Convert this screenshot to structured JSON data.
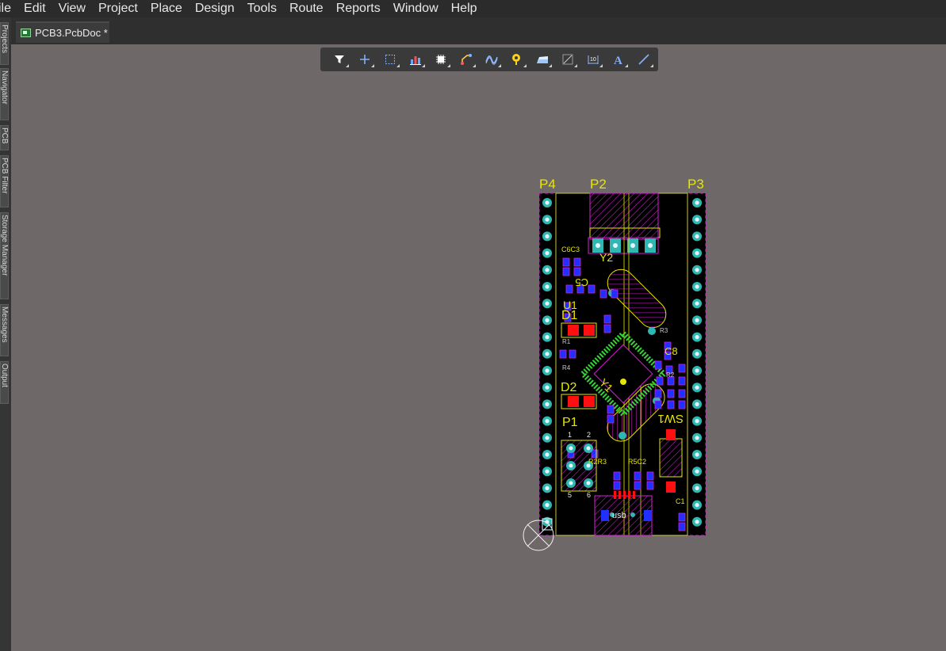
{
  "menu": {
    "items": [
      {
        "label": "ile",
        "name": "menu-file"
      },
      {
        "label": "Edit",
        "name": "menu-edit"
      },
      {
        "label": "View",
        "name": "menu-view"
      },
      {
        "label": "Project",
        "name": "menu-project"
      },
      {
        "label": "Place",
        "name": "menu-place"
      },
      {
        "label": "Design",
        "name": "menu-design"
      },
      {
        "label": "Tools",
        "name": "menu-tools"
      },
      {
        "label": "Route",
        "name": "menu-route"
      },
      {
        "label": "Reports",
        "name": "menu-reports"
      },
      {
        "label": "Window",
        "name": "menu-window"
      },
      {
        "label": "Help",
        "name": "menu-help"
      }
    ]
  },
  "tab": {
    "label": "PCB3.PcbDoc *"
  },
  "left_panels": [
    "Projects",
    "Navigator",
    "PCB",
    "PCB Filter",
    "Storage Manager",
    "Messages",
    "Output"
  ],
  "toolbar": {
    "buttons": [
      "filter-icon",
      "cross-add-icon",
      "select-rect-icon",
      "chart-icon",
      "component-icon",
      "route-icon",
      "diff-pair-icon",
      "via-icon",
      "polygon-icon",
      "rect-icon",
      "dimension-icon",
      "text-icon",
      "line-icon"
    ]
  },
  "colors": {
    "board_bg": "#000000",
    "board_outline": "#c8c24a",
    "silk": "#e6e600",
    "pad_fill": "#2fb8b2",
    "smd_pad": "#2030ff",
    "top_pad_red": "#ff1010",
    "keepout": "#d81fd8",
    "ic_pins": "#34d634",
    "workspace": "#6e6968"
  },
  "board": {
    "designators": {
      "p4": "P4",
      "p2": "P2",
      "p3": "P3",
      "y2": "Y2",
      "u1": "U1",
      "d1": "D1",
      "d2": "D2",
      "p1": "P1",
      "y1": "Y1",
      "sw1": "SW1",
      "usb": "usb",
      "c5": "C5",
      "c6c3": "C6C3",
      "r1": "R1",
      "r4": "R4",
      "c2": "R5C2",
      "c1": "C1",
      "r2r3": "R2R3",
      "one": "1",
      "two": "2",
      "five": "5",
      "six": "6",
      "c8": "C8",
      "ra": "R3",
      "rb": "R2"
    }
  }
}
